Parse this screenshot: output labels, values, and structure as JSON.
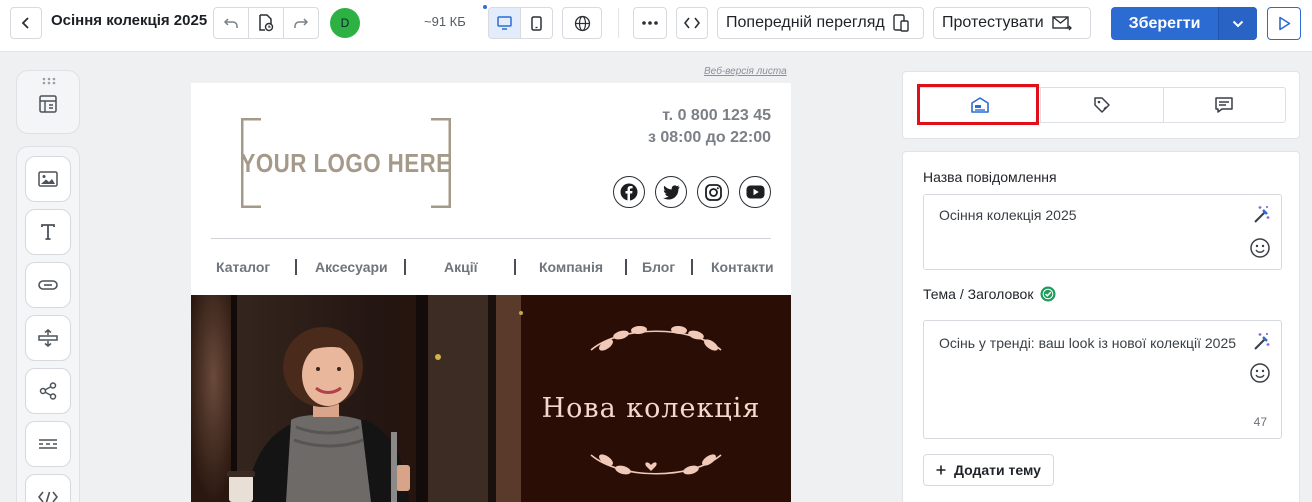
{
  "toolbar": {
    "title": "Осіння колекція 2025",
    "avatar_initial": "D",
    "size_label": "~91 КБ",
    "preview_label": "Попередній перегляд",
    "test_label": "Протестувати",
    "save_label": "Зберегти",
    "accent_color": "#2c6bd1",
    "icons": [
      "chevron-left-icon",
      "undo-icon",
      "history-icon",
      "redo-icon",
      "desktop-icon",
      "mobile-icon",
      "globe-icon",
      "more-icon",
      "code-icon",
      "preview-devices-icon",
      "send-mail-icon",
      "chevron-down-icon",
      "play-icon"
    ]
  },
  "rail": {
    "blocks_icon": "layout-icon",
    "items": [
      "image-block-icon",
      "text-block-icon",
      "button-block-icon",
      "spacer-block-icon",
      "social-block-icon",
      "divider-block-icon",
      "html-block-icon"
    ]
  },
  "email": {
    "web_version": "Веб-версія листа",
    "logo_text": "YOUR LOGO HERE",
    "phone": "т. 0 800 123 45",
    "hours": "з 08:00 до 22:00",
    "socials": [
      "facebook-icon",
      "twitter-icon",
      "instagram-icon",
      "youtube-icon"
    ],
    "menu": [
      "Каталог",
      "Аксесуари",
      "Акції",
      "Компанія",
      "Блог",
      "Контакти"
    ],
    "hero_title": "Нова колекція"
  },
  "panel": {
    "tabs": [
      "message-settings-icon",
      "design-tag-icon",
      "comments-icon"
    ],
    "name_label": "Назва повідомлення",
    "name_value": "Осіння колекція 2025",
    "subject_label": "Тема / Заголовок",
    "subject_value": "Осінь у тренді: ваш look із нової колекції 2025",
    "subject_count": "47",
    "add_subject": "Додати тему",
    "highlight_color": "#e0101a"
  }
}
